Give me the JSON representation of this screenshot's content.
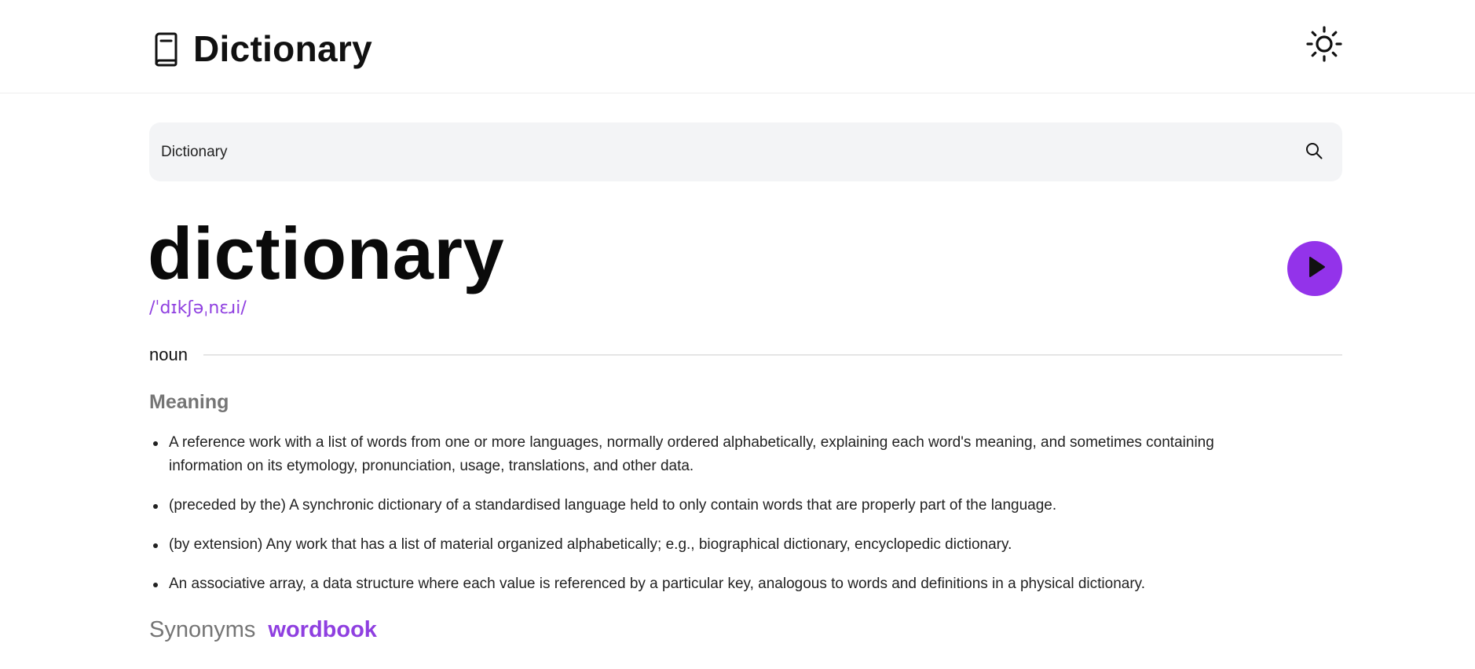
{
  "header": {
    "title": "Dictionary",
    "logo_icon": "book-icon",
    "theme_icon": "sun-icon"
  },
  "search": {
    "value": "Dictionary",
    "placeholder": "",
    "icon": "search-icon"
  },
  "entry": {
    "word": "dictionary",
    "phonetic": "/ˈdɪkʃəˌnɛɹi/",
    "play_icon": "play-icon",
    "part_of_speech": "noun",
    "meaning_heading": "Meaning",
    "definitions": [
      "A reference work with a list of words from one or more languages, normally ordered alphabetically, explaining each word's meaning, and sometimes containing information on its etymology, pronunciation, usage, translations, and other data.",
      "(preceded by the) A synchronic dictionary of a standardised language held to only contain words that are properly part of the language.",
      "(by extension) Any work that has a list of material organized alphabetically; e.g., biographical dictionary, encyclopedic dictionary.",
      "An associative array, a data structure where each value is referenced by a particular key, analogous to words and definitions in a physical dictionary."
    ],
    "synonyms_label": "Synonyms",
    "synonyms": [
      "wordbook"
    ]
  },
  "colors": {
    "accent": "#9333ea",
    "accent_text": "#8f3fe0",
    "search_bg": "#f3f4f6",
    "muted_text": "#757575"
  }
}
